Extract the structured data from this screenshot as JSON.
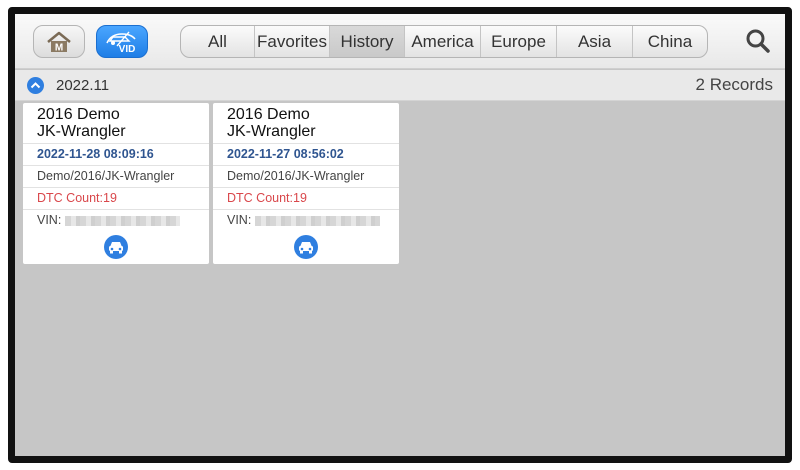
{
  "toolbar": {
    "tabs": [
      {
        "label": "All",
        "active": false
      },
      {
        "label": "Favorites",
        "active": false
      },
      {
        "label": "History",
        "active": true
      },
      {
        "label": "America",
        "active": false
      },
      {
        "label": "Europe",
        "active": false
      },
      {
        "label": "Asia",
        "active": false
      },
      {
        "label": "China",
        "active": false
      }
    ],
    "vid_label": "VID",
    "home_logo": "M"
  },
  "group": {
    "date": "2022.11",
    "records": "2 Records"
  },
  "cards": [
    {
      "title_line1": "2016 Demo",
      "title_line2": "JK-Wrangler",
      "datetime": "2022-11-28 08:09:16",
      "path": "Demo/2016/JK-Wrangler",
      "dtc": "DTC Count:19",
      "vin_label": "VIN:"
    },
    {
      "title_line1": "2016 Demo",
      "title_line2": "JK-Wrangler",
      "datetime": "2022-11-27 08:56:02",
      "path": "Demo/2016/JK-Wrangler",
      "dtc": "DTC Count:19",
      "vin_label": "VIN:"
    }
  ],
  "colors": {
    "accent": "#2f7fe0",
    "dtc": "#d9474b",
    "date_text": "#2f5590",
    "background": "#c6c6c6"
  },
  "icons": [
    "home-icon",
    "vid-icon",
    "search-icon",
    "collapse-up-icon",
    "car-icon"
  ]
}
